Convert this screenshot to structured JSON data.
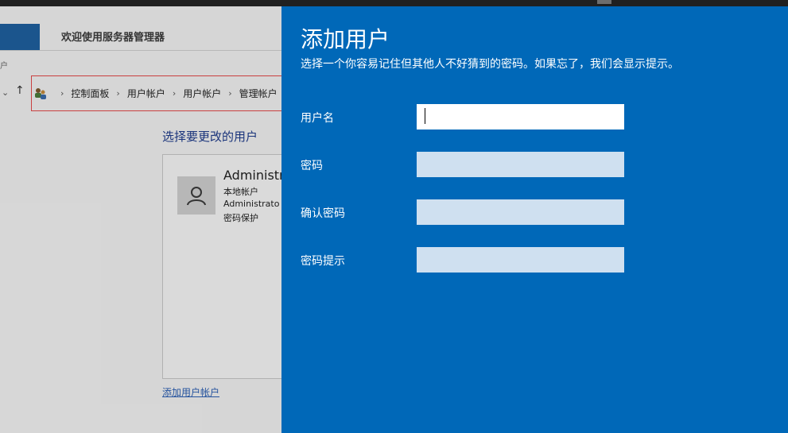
{
  "background": {
    "header_title": "欢迎使用服务器管理器",
    "small_text": "户",
    "breadcrumb": [
      "控制面板",
      "用户帐户",
      "用户帐户",
      "管理帐户"
    ],
    "section_title": "选择要更改的用户",
    "user": {
      "name": "Administr",
      "type": "本地帐户",
      "group": "Administrato",
      "protection": "密码保护"
    },
    "add_link": "添加用户帐户"
  },
  "dialog": {
    "title": "添加用户",
    "subtitle": "选择一个你容易记住但其他人不好猜到的密码。如果忘了，我们会显示提示。",
    "fields": [
      {
        "label": "用户名",
        "value": ""
      },
      {
        "label": "密码",
        "value": ""
      },
      {
        "label": "确认密码",
        "value": ""
      },
      {
        "label": "密码提示",
        "value": ""
      }
    ]
  },
  "colors": {
    "panel_bg": "#0068b8",
    "input_bg": "#cfe0f0",
    "active_input_bg": "#ffffff",
    "breadcrumb_border": "#e04848"
  }
}
